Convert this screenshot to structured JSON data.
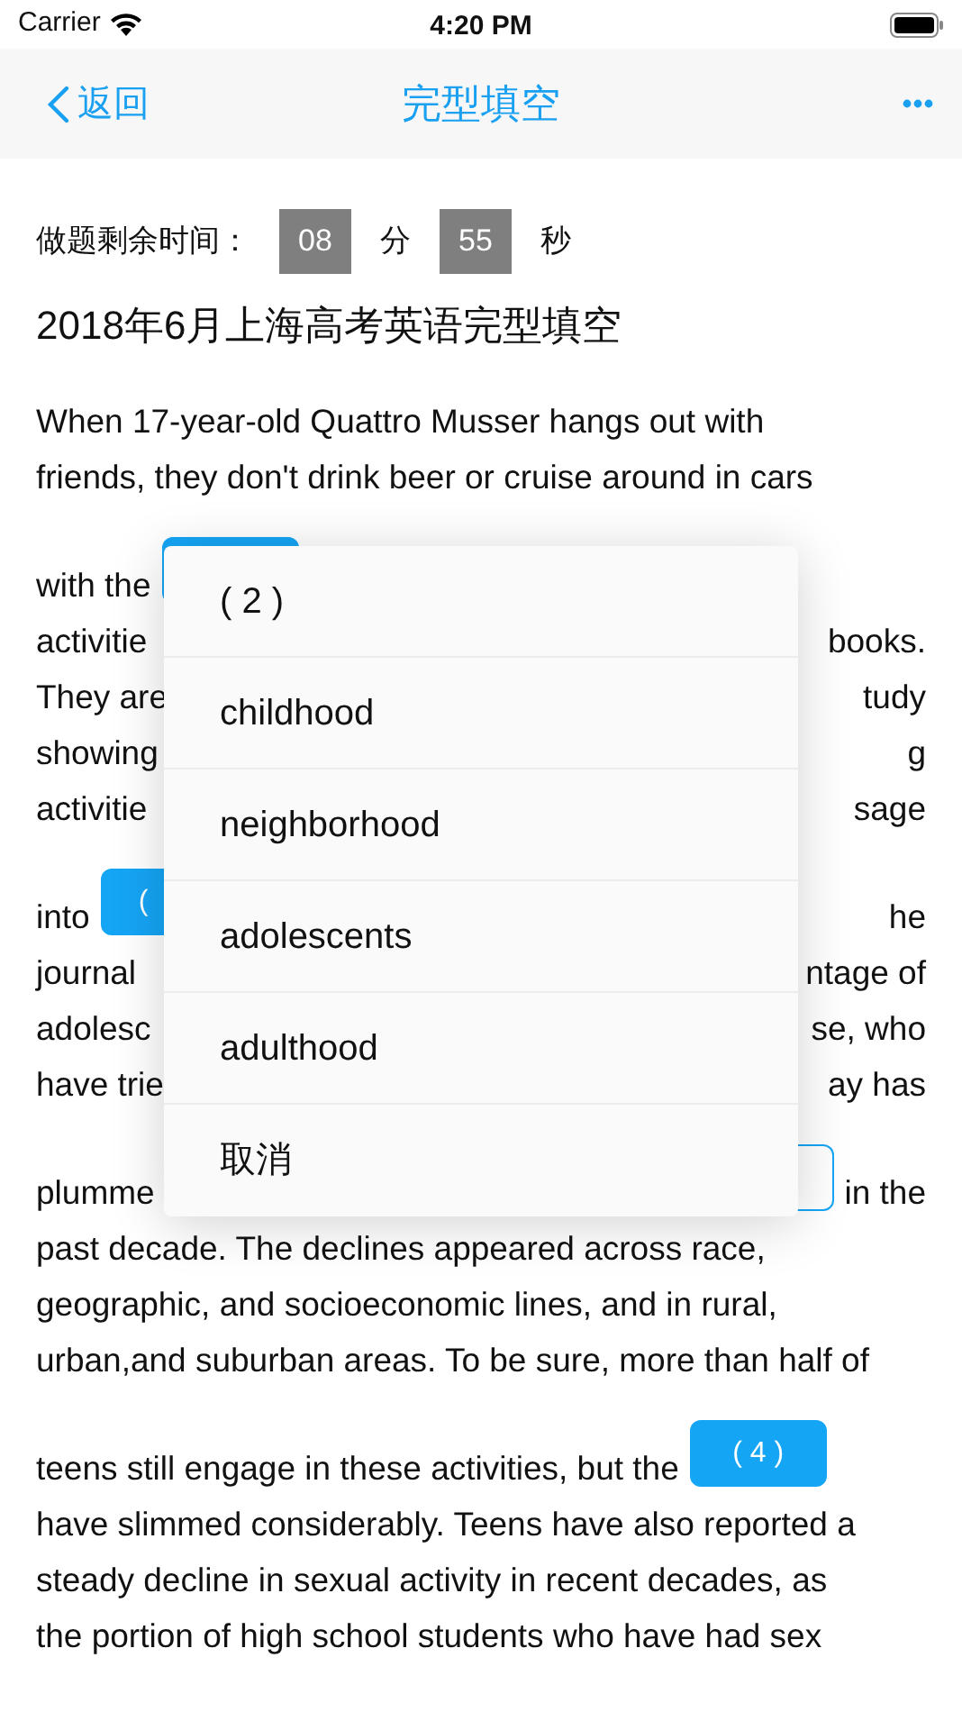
{
  "status_bar": {
    "carrier": "Carrier",
    "time": "4:20 PM"
  },
  "nav_bar": {
    "back": "返回",
    "title": "完型填空"
  },
  "timer": {
    "label": "做题剩余时间：",
    "minutes": "08",
    "minutes_unit": "分",
    "seconds": "55",
    "seconds_unit": "秒"
  },
  "title": "2018年6月上海高考英语完型填空",
  "passage_lines": [
    [
      {
        "kind": "text",
        "text": "When 17-year-old Quattro Musser hangs out with"
      }
    ],
    [
      {
        "kind": "text",
        "text": "friends, they don't drink beer or cruise around in cars"
      }
    ],
    [
      {
        "kind": "text",
        "text": "with the"
      },
      {
        "kind": "blank",
        "selected": false
      },
      {
        "kind": "gap"
      }
    ],
    [
      {
        "kind": "text",
        "text": "activitie"
      },
      {
        "kind": "gap"
      },
      {
        "kind": "text",
        "text": "books."
      }
    ],
    [
      {
        "kind": "text",
        "text": "They are"
      },
      {
        "kind": "gap"
      },
      {
        "kind": "text",
        "text": "tudy"
      }
    ],
    [
      {
        "kind": "text",
        "text": "showing"
      },
      {
        "kind": "gap"
      },
      {
        "kind": "text",
        "text": "g"
      }
    ],
    [
      {
        "kind": "text",
        "text": "activitie"
      },
      {
        "kind": "gap"
      },
      {
        "kind": "text",
        "text": "sage"
      }
    ],
    [
      {
        "kind": "text",
        "text": "into"
      },
      {
        "kind": "blank",
        "label": "(",
        "selected": false
      },
      {
        "kind": "gap"
      },
      {
        "kind": "text",
        "text": "he"
      }
    ],
    [
      {
        "kind": "text",
        "text": "journal"
      },
      {
        "kind": "gap"
      },
      {
        "kind": "text",
        "text": "ntage of"
      }
    ],
    [
      {
        "kind": "text",
        "text": "adolesc"
      },
      {
        "kind": "gap"
      },
      {
        "kind": "text",
        "text": "se, who"
      }
    ],
    [
      {
        "kind": "text",
        "text": "have trie"
      },
      {
        "kind": "gap"
      },
      {
        "kind": "text",
        "text": "ay has"
      }
    ],
    [
      {
        "kind": "text",
        "text": "plumme"
      },
      {
        "kind": "gap"
      },
      {
        "kind": "blank",
        "selected": true
      },
      {
        "kind": "text",
        "text": "in the"
      }
    ],
    [
      {
        "kind": "text",
        "text": "past decade. The declines appeared across race,"
      }
    ],
    [
      {
        "kind": "text",
        "text": "geographic, and socioeconomic lines, and in rural,"
      }
    ],
    [
      {
        "kind": "text",
        "text": "urban,and suburban areas. To be sure, more than half of"
      }
    ],
    [
      {
        "kind": "text",
        "text": "teens still engage in these activities, but the"
      },
      {
        "kind": "blank",
        "label": "( 4 )",
        "selected": false
      }
    ],
    [
      {
        "kind": "text",
        "text": "have slimmed considerably. Teens have also reported a"
      }
    ],
    [
      {
        "kind": "text",
        "text": "steady decline in sexual activity in recent decades, as"
      }
    ],
    [
      {
        "kind": "text",
        "text": "the portion of high school students who have had sex"
      }
    ]
  ],
  "popup": {
    "header": "( 2 )",
    "options": [
      "childhood",
      "neighborhood",
      "adolescents",
      "adulthood"
    ],
    "cancel": "取消"
  }
}
